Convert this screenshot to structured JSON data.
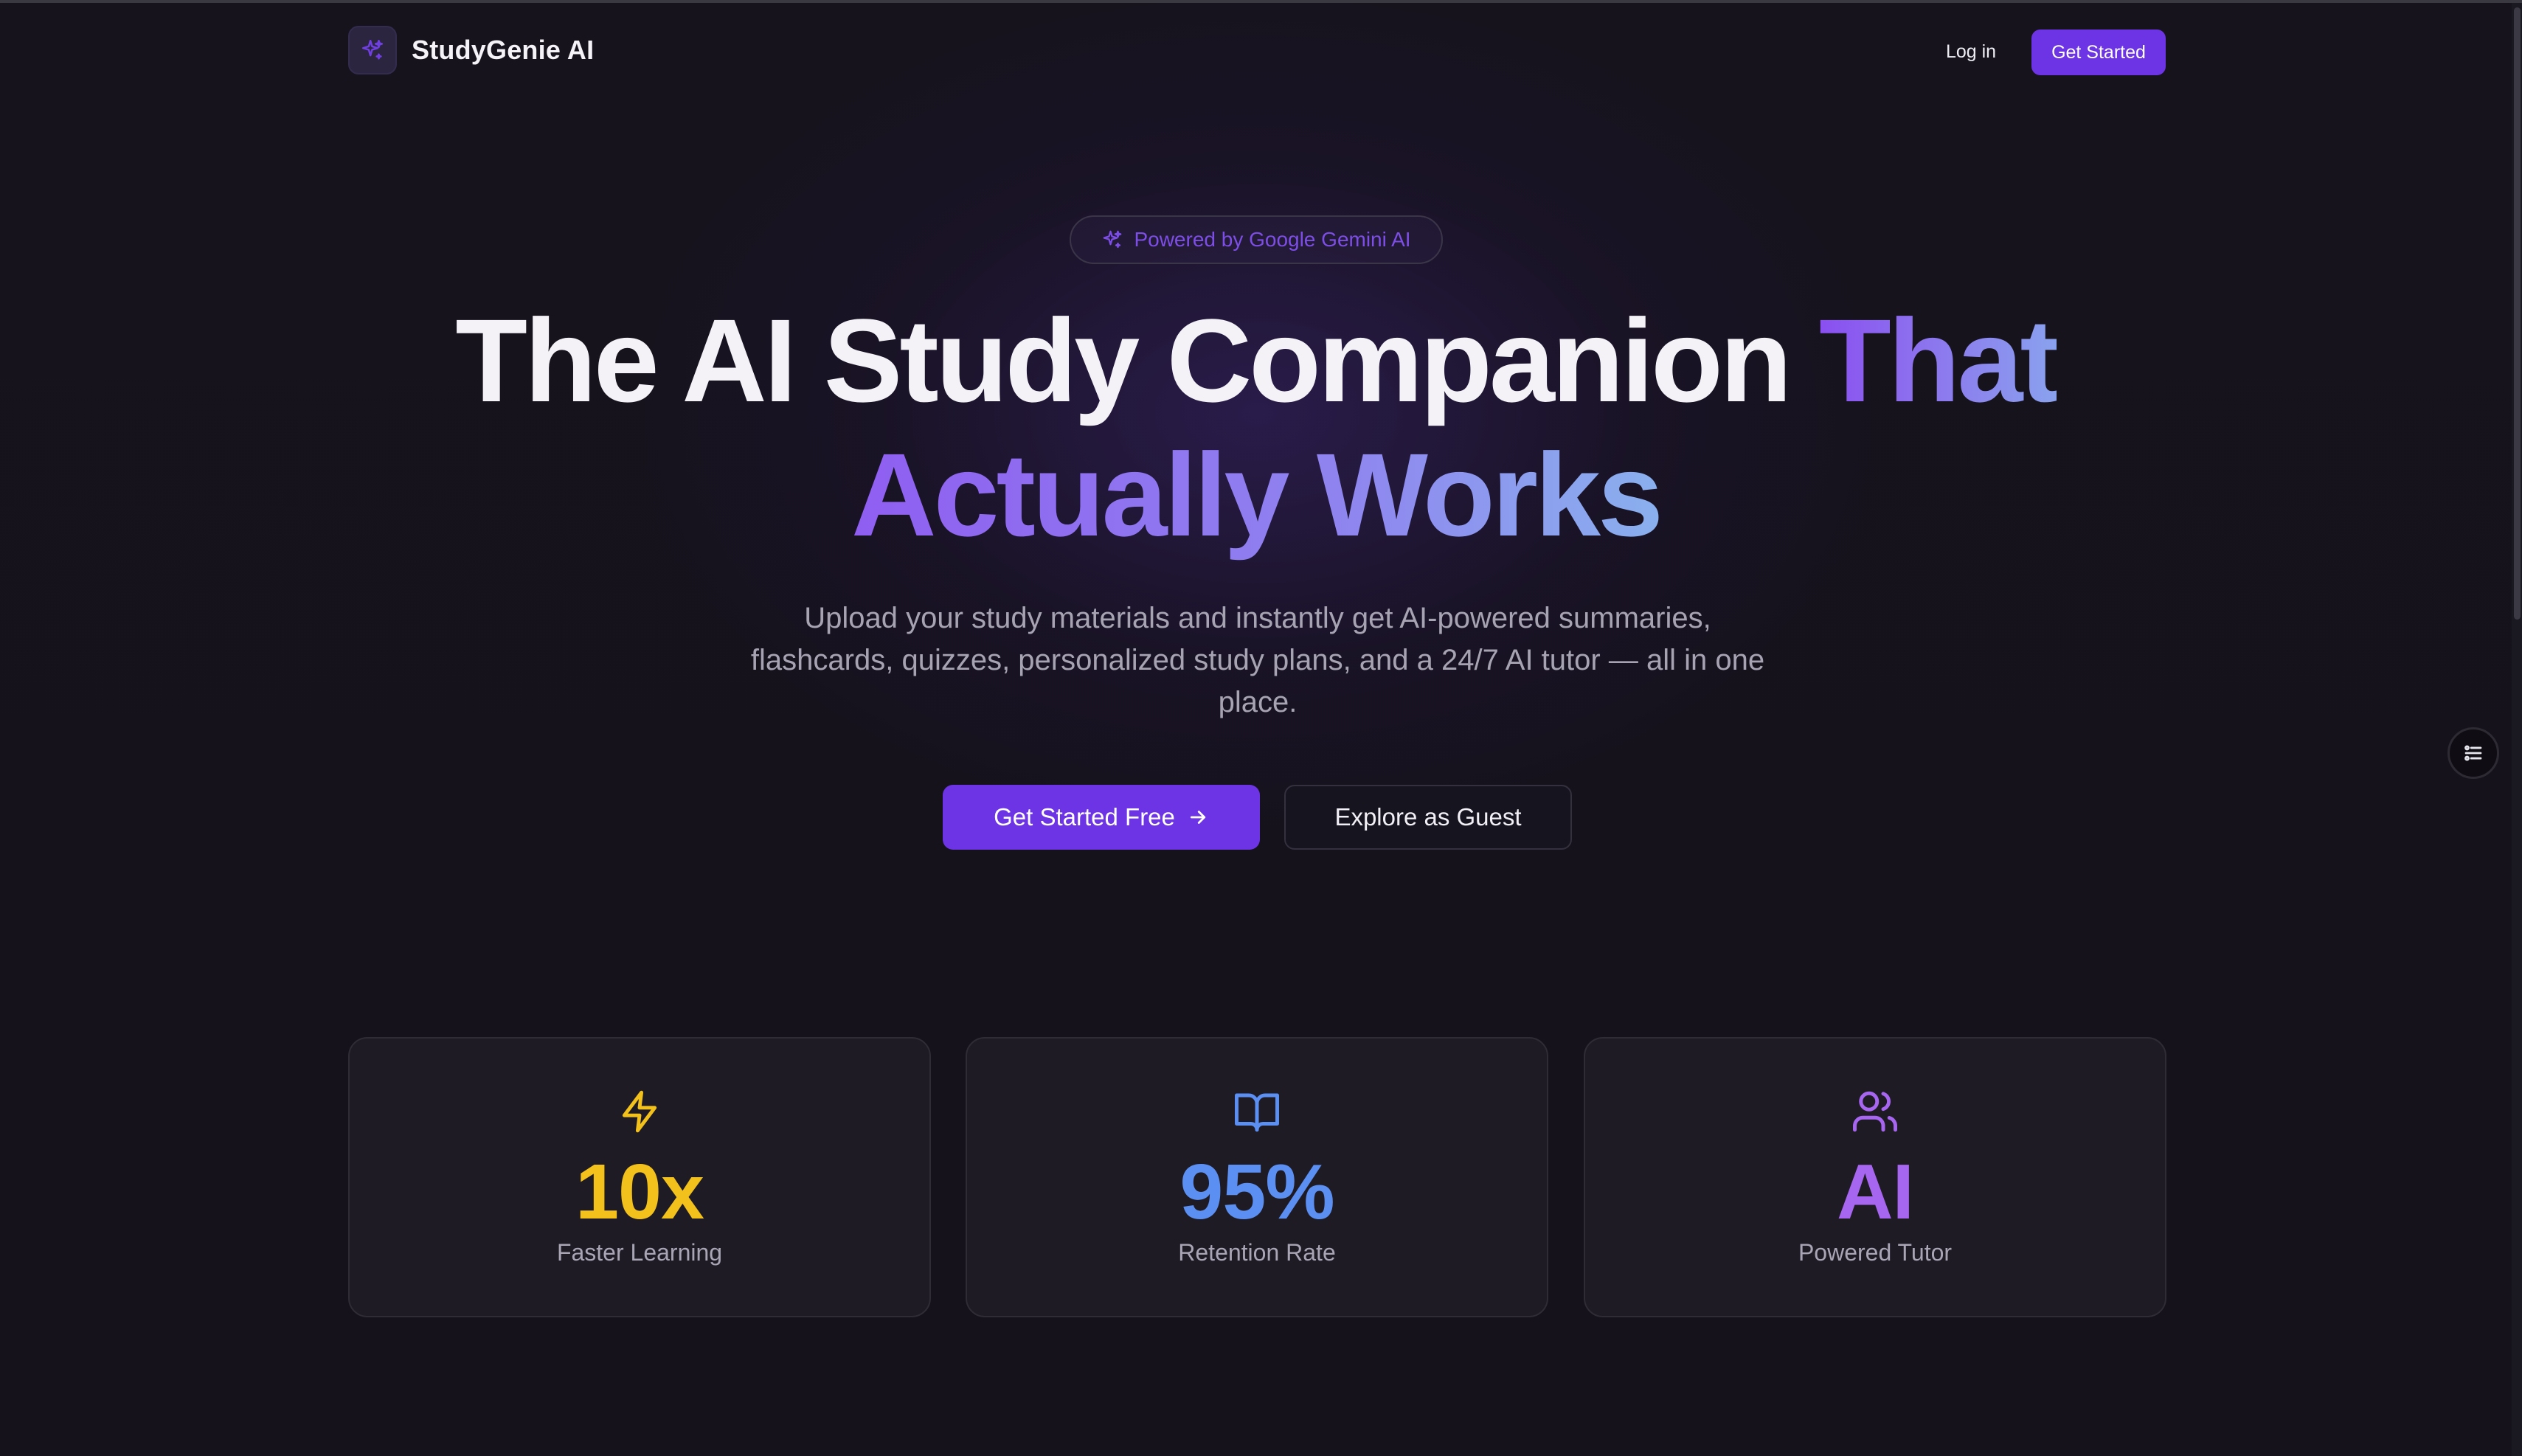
{
  "nav": {
    "brand_name": "StudyGenie AI",
    "brand_icon": "sparkles-icon",
    "login_label": "Log in",
    "cta_label": "Get Started"
  },
  "hero": {
    "badge_icon": "sparkles-icon",
    "badge_text": "Powered by Google Gemini AI",
    "headline_part1": "The AI Study Companion ",
    "headline_accent1": "That",
    "headline_accent2": "Actually Works",
    "subtitle": "Upload your study materials and instantly get AI-powered summaries, flashcards, quizzes, personalized study plans, and a 24/7 AI tutor — all in one place.",
    "primary_button": "Get Started Free",
    "primary_button_icon": "arrow-right-icon",
    "secondary_button": "Explore as Guest"
  },
  "stats": [
    {
      "icon": "lightning-icon",
      "value": "10x",
      "label": "Faster Learning",
      "color": "#f2c11c"
    },
    {
      "icon": "book-open-icon",
      "value": "95%",
      "label": "Retention Rate",
      "color": "#5b8ff2"
    },
    {
      "icon": "users-icon",
      "value": "AI",
      "label": "Powered Tutor",
      "color": "#a766f0"
    }
  ],
  "colors": {
    "background": "#15121c",
    "accent": "#6d34e6",
    "badge_text": "#7d4ee6",
    "card_bg": "#1e1b25"
  }
}
